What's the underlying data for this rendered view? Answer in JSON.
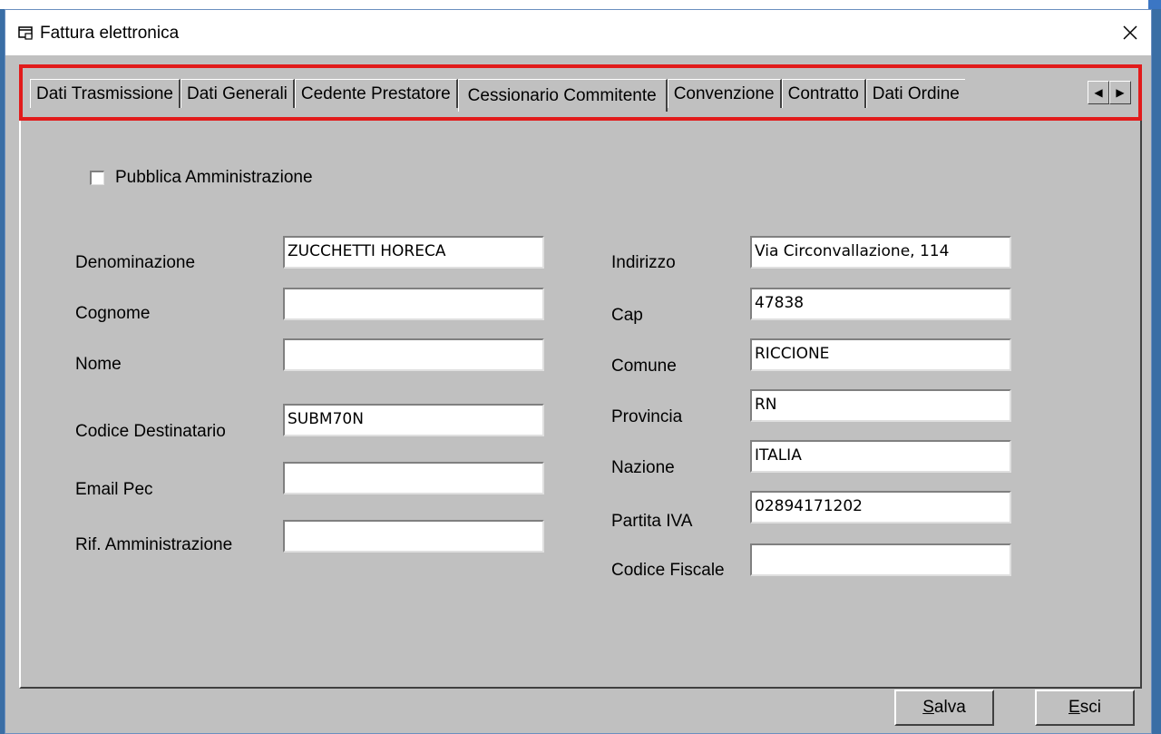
{
  "window": {
    "title": "Fattura elettronica",
    "close_glyph": "✕"
  },
  "tabs": [
    {
      "label": "Dati Trasmissione",
      "active": false
    },
    {
      "label": "Dati Generali",
      "active": false
    },
    {
      "label": "Cedente Prestatore",
      "active": false
    },
    {
      "label": "Cessionario Commitente",
      "active": true
    },
    {
      "label": "Convenzione",
      "active": false
    },
    {
      "label": "Contratto",
      "active": false
    },
    {
      "label": "Dati Ordine",
      "active": false
    }
  ],
  "tab_scroll": {
    "left": "◀",
    "right": "▶"
  },
  "form": {
    "pubblica_amministrazione": {
      "label": "Pubblica Amministrazione",
      "checked": false
    },
    "left": {
      "denominazione": {
        "label": "Denominazione",
        "value": "ZUCCHETTI HORECA"
      },
      "cognome": {
        "label": "Cognome",
        "value": ""
      },
      "nome": {
        "label": "Nome",
        "value": ""
      },
      "codice_destinatario": {
        "label": "Codice Destinatario",
        "value": "SUBM70N"
      },
      "email_pec": {
        "label": "Email Pec",
        "value": ""
      },
      "rif_amministrazione": {
        "label": "Rif. Amministrazione",
        "value": ""
      }
    },
    "right": {
      "indirizzo": {
        "label": "Indirizzo",
        "value": "Via Circonvallazione, 114"
      },
      "cap": {
        "label": "Cap",
        "value": "47838"
      },
      "comune": {
        "label": "Comune",
        "value": "RICCIONE"
      },
      "provincia": {
        "label": "Provincia",
        "value": "RN"
      },
      "nazione": {
        "label": "Nazione",
        "value": "ITALIA"
      },
      "partita_iva": {
        "label": "Partita IVA",
        "value": "02894171202"
      },
      "codice_fiscale": {
        "label": "Codice Fiscale",
        "value": ""
      }
    }
  },
  "buttons": {
    "salva": {
      "accel": "S",
      "rest": "alva"
    },
    "esci": {
      "accel": "E",
      "rest": "sci"
    }
  },
  "colors": {
    "highlight_border": "#e21b1b",
    "window_face": "#c0c0c0"
  }
}
